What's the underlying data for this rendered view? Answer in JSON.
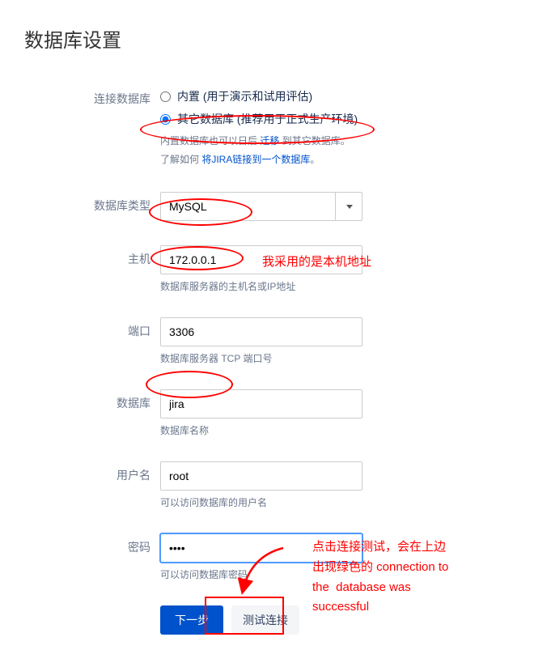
{
  "page": {
    "title": "数据库设置"
  },
  "connect": {
    "label": "连接数据库",
    "builtin": {
      "label": "内置 (用于演示和试用评估)",
      "checked": false
    },
    "other": {
      "label": "其它数据库 (推荐用于正式生产环境)",
      "checked": true
    },
    "help1_prefix": "内置数据库也可以日后 ",
    "help1_link": "迁移",
    "help1_suffix": " 到其它数据库。",
    "help2_prefix": "了解如何 ",
    "help2_link": "将JIRA链接到一个数据库",
    "help2_suffix": "。"
  },
  "dbtype": {
    "label": "数据库类型",
    "value": "MySQL"
  },
  "host": {
    "label": "主机",
    "value": "172.0.0.1",
    "desc": "数据库服务器的主机名或IP地址"
  },
  "port": {
    "label": "端口",
    "value": "3306",
    "desc": "数据库服务器 TCP 端口号"
  },
  "database": {
    "label": "数据库",
    "value": "jira",
    "desc": "数据库名称"
  },
  "username": {
    "label": "用户名",
    "value": "root",
    "desc": "可以访问数据库的用户名"
  },
  "password": {
    "label": "密码",
    "value": "••••",
    "desc": "可以访问数据库密码"
  },
  "buttons": {
    "next": "下一步",
    "test": "测试连接"
  },
  "annotations": {
    "host_note": "我采用的是本机地址",
    "test_note": "点击连接测试，会在上边\n出现绿色的 connection to\nthe  database was\nsuccessful"
  }
}
